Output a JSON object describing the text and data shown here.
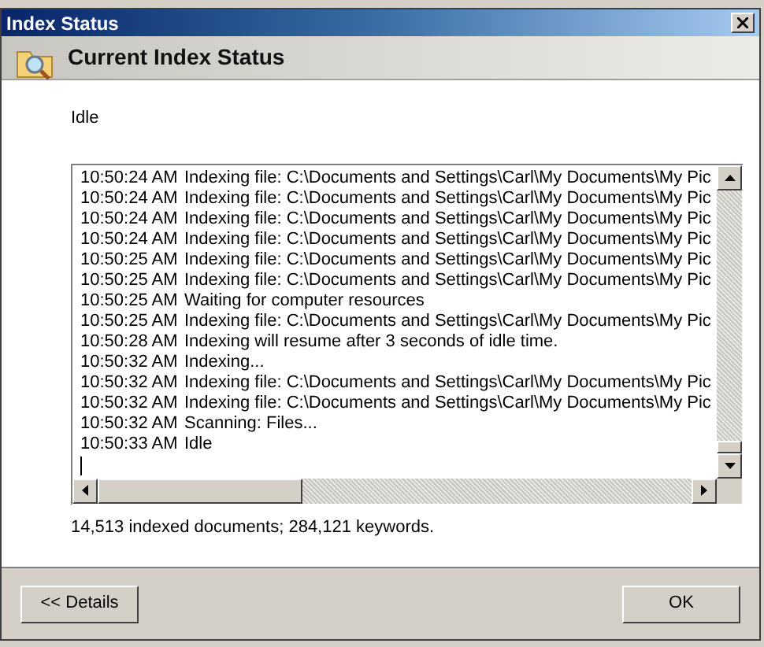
{
  "window": {
    "title": "Index Status"
  },
  "header": {
    "title": "Current Index Status"
  },
  "status": "Idle",
  "log": [
    {
      "time": "10:50:24 AM",
      "message": "Indexing file: C:\\Documents and Settings\\Carl\\My Documents\\My Pic"
    },
    {
      "time": "10:50:24 AM",
      "message": "Indexing file: C:\\Documents and Settings\\Carl\\My Documents\\My Pic"
    },
    {
      "time": "10:50:24 AM",
      "message": "Indexing file: C:\\Documents and Settings\\Carl\\My Documents\\My Pic"
    },
    {
      "time": "10:50:24 AM",
      "message": "Indexing file: C:\\Documents and Settings\\Carl\\My Documents\\My Pic"
    },
    {
      "time": "10:50:25 AM",
      "message": "Indexing file: C:\\Documents and Settings\\Carl\\My Documents\\My Pic"
    },
    {
      "time": "10:50:25 AM",
      "message": "Indexing file: C:\\Documents and Settings\\Carl\\My Documents\\My Pic"
    },
    {
      "time": "10:50:25 AM",
      "message": "Waiting for computer resources"
    },
    {
      "time": "10:50:25 AM",
      "message": "Indexing file: C:\\Documents and Settings\\Carl\\My Documents\\My Pic"
    },
    {
      "time": "10:50:28 AM",
      "message": "Indexing will resume after 3 seconds of idle time."
    },
    {
      "time": "10:50:32 AM",
      "message": "Indexing..."
    },
    {
      "time": "10:50:32 AM",
      "message": "Indexing file: C:\\Documents and Settings\\Carl\\My Documents\\My Pic"
    },
    {
      "time": "10:50:32 AM",
      "message": "Indexing file: C:\\Documents and Settings\\Carl\\My Documents\\My Pic"
    },
    {
      "time": "10:50:32 AM",
      "message": "Scanning: Files..."
    },
    {
      "time": "10:50:33 AM",
      "message": "Idle"
    }
  ],
  "summary": "14,513 indexed documents; 284,121 keywords.",
  "buttons": {
    "details": "<< Details",
    "ok": "OK"
  }
}
